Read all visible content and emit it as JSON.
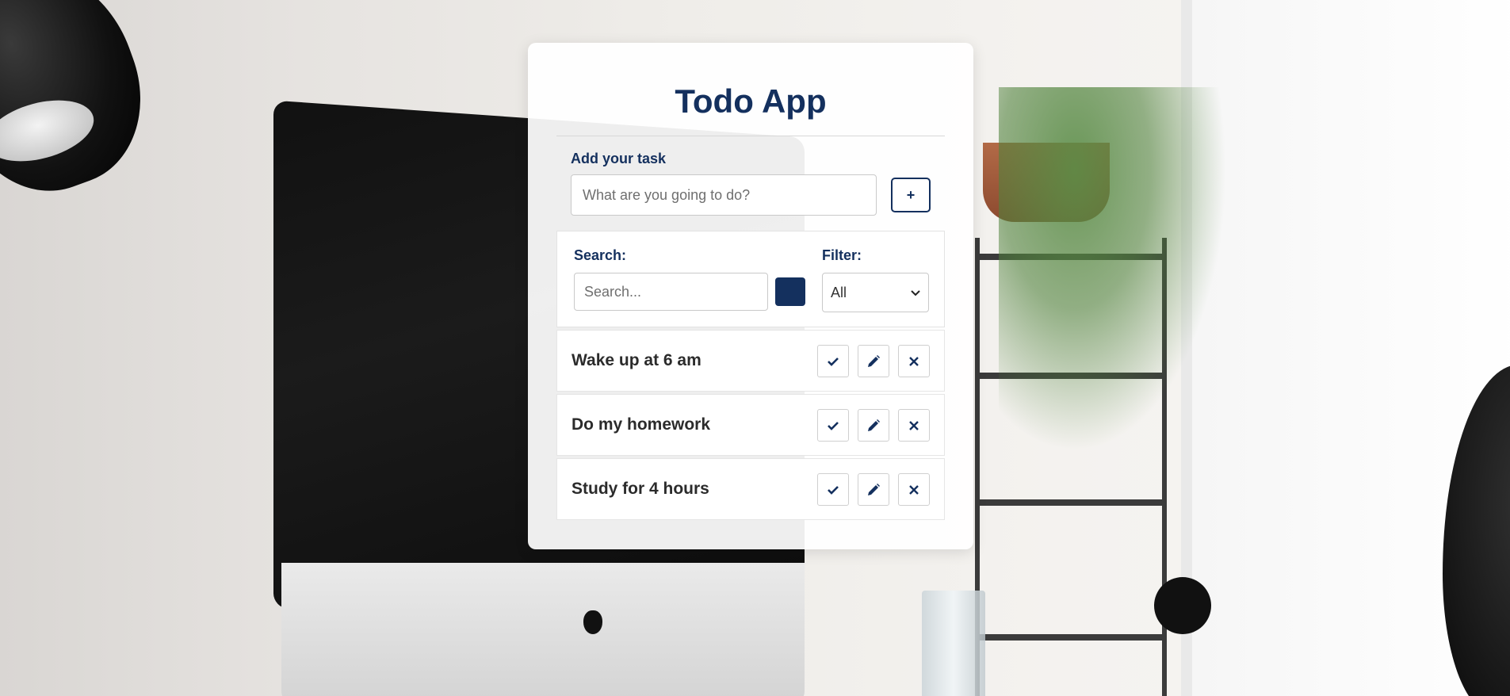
{
  "app": {
    "title": "Todo App"
  },
  "add_task": {
    "label": "Add your task",
    "input_placeholder": "What are you going to do?",
    "input_value": "",
    "add_button_label": "+"
  },
  "search": {
    "label": "Search:",
    "placeholder": "Search...",
    "value": "",
    "button_icon": "search-icon"
  },
  "filter": {
    "label": "Filter:",
    "selected": "All",
    "icon": "chevron-down-icon"
  },
  "todos": [
    {
      "text": "Wake up at 6 am",
      "actions": [
        "check-icon",
        "pencil-icon",
        "close-icon"
      ]
    },
    {
      "text": "Do my homework",
      "actions": [
        "check-icon",
        "pencil-icon",
        "close-icon"
      ]
    },
    {
      "text": "Study for 4 hours",
      "actions": [
        "check-icon",
        "pencil-icon",
        "close-icon"
      ]
    }
  ],
  "colors": {
    "accent": "#14305e",
    "card_background": "#ffffff",
    "text": "#2b2b2b"
  }
}
